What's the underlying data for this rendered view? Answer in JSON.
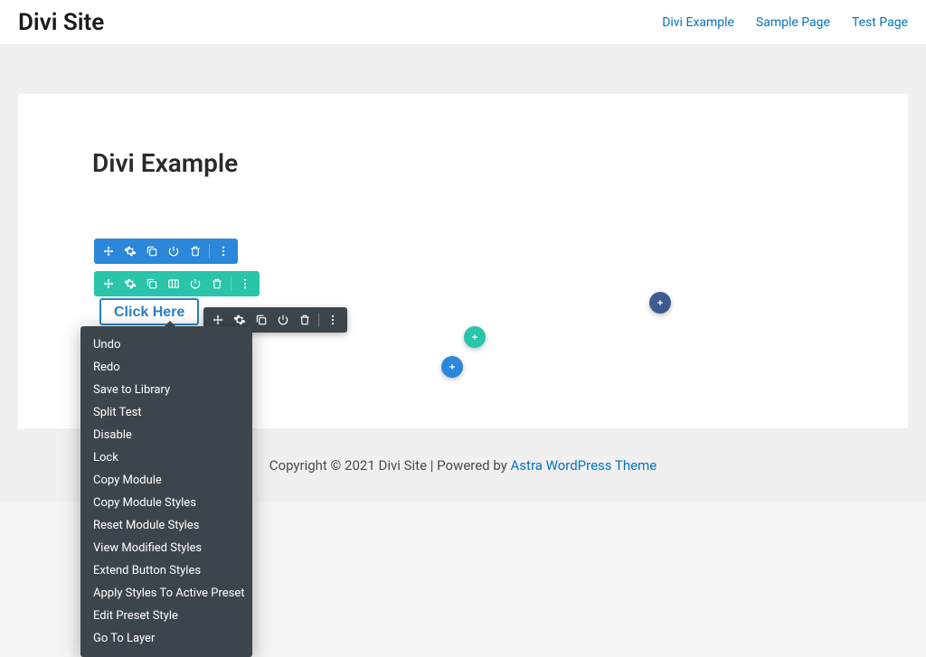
{
  "header": {
    "site_title": "Divi Site",
    "nav": [
      "Divi Example",
      "Sample Page",
      "Test Page"
    ]
  },
  "page": {
    "title": "Divi Example",
    "button_label": "Click Here"
  },
  "context_menu": {
    "items": [
      "Undo",
      "Redo",
      "Save to Library",
      "Split Test",
      "Disable",
      "Lock",
      "Copy Module",
      "Copy Module Styles",
      "Reset Module Styles",
      "View Modified Styles",
      "Extend Button Styles",
      "Apply Styles To Active Preset",
      "Edit Preset Style",
      "Go To Layer"
    ]
  },
  "footer": {
    "text": "Copyright © 2021 Divi Site | Powered by ",
    "link": "Astra WordPress Theme"
  }
}
